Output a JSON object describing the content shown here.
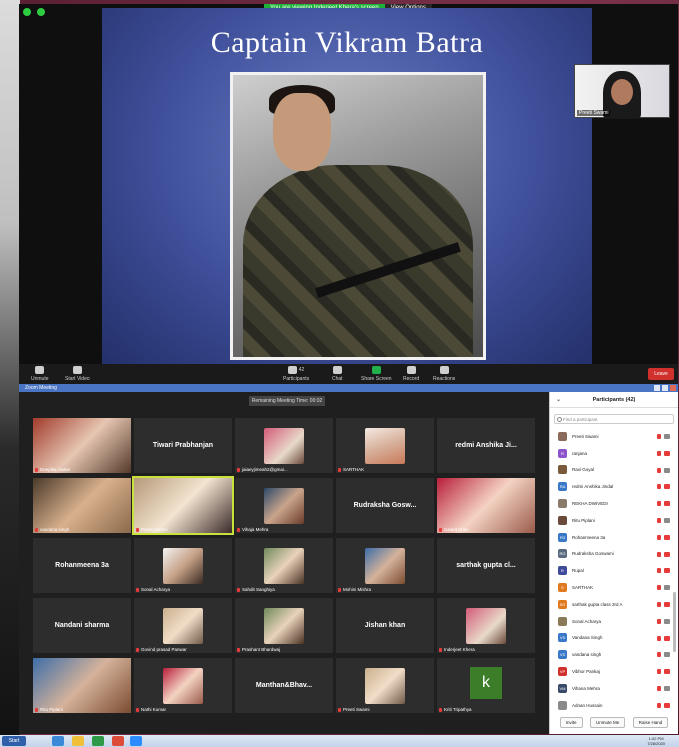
{
  "top": {
    "banner_message": "You are viewing Inderjeet Khera's screen",
    "view_options": "View Options",
    "slide_title": "Captain Vikram Batra",
    "self_view_name": "Preeti Swami",
    "toolbar": {
      "unmute": "Unmute",
      "start_video": "Start Video",
      "participants": "Participants",
      "participants_count": "42",
      "chat": "Chat",
      "share_screen": "Share Screen",
      "record": "Record",
      "reactions": "Reactions",
      "leave": "Leave"
    }
  },
  "bottom": {
    "title": "Zoom Meeting",
    "remaining": "Remaining Meeting Time: 00:02",
    "tiles": [
      {
        "name": "Deepika Yadav",
        "type": "cam",
        "cls": "c1"
      },
      {
        "name": "Tiwari Prabhanjan",
        "type": "text"
      },
      {
        "name": "jaiaeyjimeah2@gmai...",
        "type": "cam",
        "cls": "c2"
      },
      {
        "name": "SARTHAK",
        "type": "cam",
        "cls": "c3"
      },
      {
        "name": "redmi Anshika Ji...",
        "type": "text"
      },
      {
        "name": "vandana singh",
        "type": "cam",
        "cls": "c4"
      },
      {
        "name": "Preeti Swami",
        "type": "cam",
        "cls": "c5",
        "active": true
      },
      {
        "name": "Vihaja Mehra",
        "type": "cam",
        "cls": "c6"
      },
      {
        "name": "Rudraksha Gosw...",
        "type": "text"
      },
      {
        "name": "Gewrit Khan",
        "type": "cam",
        "cls": "c7"
      },
      {
        "name": "Rohanmeena 3a",
        "type": "text"
      },
      {
        "name": "Sonal Acharya",
        "type": "cam",
        "cls": "c8"
      },
      {
        "name": "Sahdit Sanghiya",
        "type": "cam",
        "cls": "c9"
      },
      {
        "name": "Mohini Mishra",
        "type": "cam",
        "cls": "c10"
      },
      {
        "name": "sarthak gupta cl...",
        "type": "text"
      },
      {
        "name": "Nandani sharma",
        "type": "text"
      },
      {
        "name": "Govind prasad Panwar",
        "type": "cam",
        "cls": "c11"
      },
      {
        "name": "Prashant Bhardwaj",
        "type": "cam",
        "cls": "c9"
      },
      {
        "name": "Jishan khan",
        "type": "text"
      },
      {
        "name": "Inderjeet Khera",
        "type": "cam",
        "cls": "c2"
      },
      {
        "name": "Ritu Piplani",
        "type": "cam",
        "cls": "c10"
      },
      {
        "name": "Nathi Kumar",
        "type": "cam",
        "cls": "c7"
      },
      {
        "name": "Manthan&Bhav...",
        "type": "text"
      },
      {
        "name": "Preeti Swami",
        "type": "cam",
        "cls": "c11"
      },
      {
        "name": "Kriti Tripathya",
        "type": "k",
        "letter": "k"
      }
    ]
  },
  "panel": {
    "title": "Participants (42)",
    "search_placeholder": "Find a participant",
    "participants": [
      {
        "name": "Preeti Swami",
        "initials": "",
        "color": "#8a6a5a",
        "video": true
      },
      {
        "name": "ranjana",
        "initials": "R",
        "color": "#8d55c9",
        "video": false
      },
      {
        "name": "Ravi Goyal",
        "initials": "",
        "color": "#7a5a3a",
        "video": true
      },
      {
        "name": "redmi Anshika Jindal",
        "initials": "RA",
        "color": "#3a78c8",
        "video": false
      },
      {
        "name": "REKHA DWIVEDI",
        "initials": "",
        "color": "#8a7a6a",
        "video": false
      },
      {
        "name": "Ritu Piplani",
        "initials": "",
        "color": "#6a4a3a",
        "video": true
      },
      {
        "name": "Rohanmeena 3a",
        "initials": "R3",
        "color": "#3a78c8",
        "video": false
      },
      {
        "name": "Rudraksha Goswami",
        "initials": "RG",
        "color": "#5c6a80",
        "video": false
      },
      {
        "name": "Rupal",
        "initials": "R",
        "color": "#3f4a9a",
        "video": false
      },
      {
        "name": "SARTHAK",
        "initials": "S",
        "color": "#e07a1f",
        "video": true
      },
      {
        "name": "sarthak gupta class 3rd A",
        "initials": "SG",
        "color": "#e07a1f",
        "video": false
      },
      {
        "name": "Sonal Acharya",
        "initials": "",
        "color": "#8a7a5a",
        "video": true
      },
      {
        "name": "Vandana Singh",
        "initials": "VS",
        "color": "#3a78c8",
        "video": false
      },
      {
        "name": "vandana singh",
        "initials": "VS",
        "color": "#3a78c8",
        "video": true
      },
      {
        "name": "Vibhor Pankaj",
        "initials": "VP",
        "color": "#d0312d",
        "video": false
      },
      {
        "name": "Vihana Mehra",
        "initials": "VM",
        "color": "#3a4a6a",
        "video": true
      },
      {
        "name": "Adnan Hussain",
        "initials": "",
        "color": "#8a8a8a",
        "video": false
      }
    ],
    "footer": {
      "invite": "Invite",
      "mute_me": "Unmute Me",
      "raise_hand": "Raise Hand"
    }
  },
  "taskbar": {
    "start": "Start",
    "time": "1:02 PM",
    "date": "7/28/2020"
  }
}
